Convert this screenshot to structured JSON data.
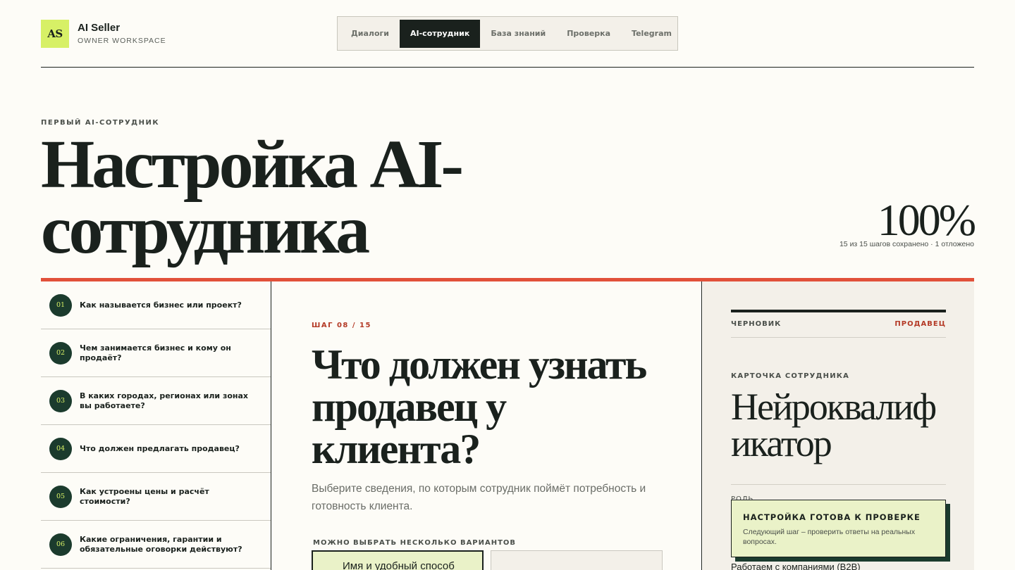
{
  "brand": {
    "logo": "AS",
    "name": "AI Seller",
    "subtitle": "OWNER WORKSPACE"
  },
  "nav": {
    "tabs": [
      {
        "label": "Диалоги",
        "active": false
      },
      {
        "label": "AI-сотрудник",
        "active": true
      },
      {
        "label": "База знаний",
        "active": false
      },
      {
        "label": "Проверка",
        "active": false
      },
      {
        "label": "Telegram",
        "active": false
      }
    ]
  },
  "hero": {
    "eyebrow": "ПЕРВЫЙ AI-СОТРУДНИК",
    "title": "Настройка AI-сотрудника",
    "percent": "100%",
    "progress_note": "15 из 15 шагов сохранено · 1 отложено"
  },
  "progress": {
    "value": 100,
    "unit": "%"
  },
  "steps": [
    {
      "num": "01",
      "label": "Как называется бизнес или проект?"
    },
    {
      "num": "02",
      "label": "Чем занимается бизнес и кому он продаёт?"
    },
    {
      "num": "03",
      "label": "В каких городах, регионах или зонах вы работаете?"
    },
    {
      "num": "04",
      "label": "Что должен предлагать продавец?"
    },
    {
      "num": "05",
      "label": "Как устроены цены и расчёт стоимости?"
    },
    {
      "num": "06",
      "label": "Какие ограничения, гарантии и обязательные оговорки действуют?"
    }
  ],
  "question": {
    "counter_prefix": "ШАГ",
    "counter": "08 / 15",
    "title": "Что должен узнать продавец у клиента?",
    "description": "Выберите сведения, по которым сотрудник поймёт потребность и готовность клиента.",
    "multi_hint": "МОЖНО ВЫБРАТЬ НЕСКОЛЬКО ВАРИАНТОВ",
    "options": [
      {
        "label": "Имя и удобный способ",
        "selected": true
      },
      {
        "label": "",
        "selected": false
      }
    ]
  },
  "draft": {
    "label": "ЧЕРНОВИК",
    "role": "ПРОДАВЕЦ",
    "card_label": "КАРТОЧКА СОТРУДНИКА",
    "card_name": "Нейроквалификатор",
    "field_hint": "РОЛЬ",
    "field_value": "Работаем с компаниями (B2B)"
  },
  "toast": {
    "title": "НАСТРОЙКА ГОТОВА К ПРОВЕРКЕ",
    "body": "Следующий шаг – проверить ответы на реальных вопросах."
  },
  "colors": {
    "background": "#fdfcf7",
    "ink": "#1a211d",
    "accent_lime": "#d7f066",
    "accent_red": "#e1513a",
    "deep_green": "#1b3b2d",
    "panel": "#f3f0e9"
  }
}
